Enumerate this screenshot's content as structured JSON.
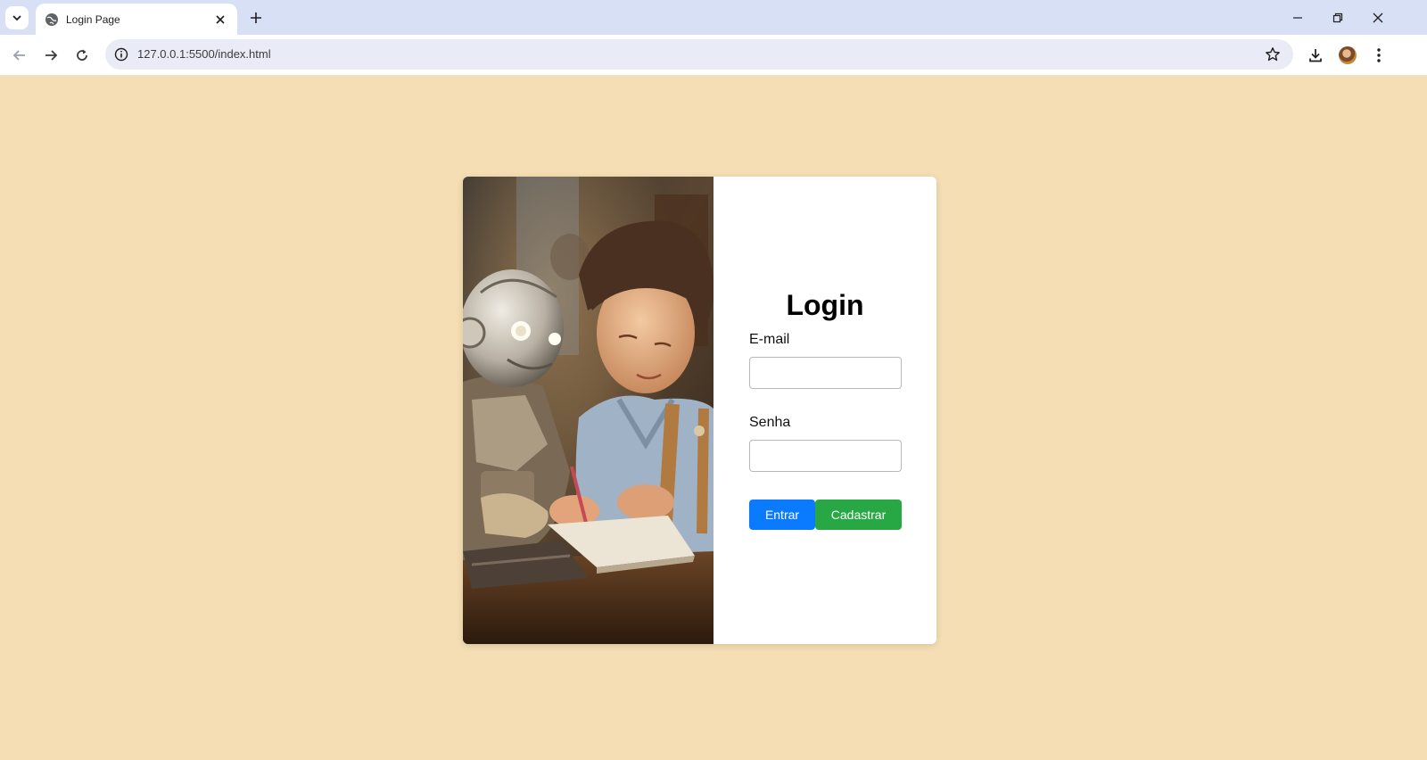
{
  "browser": {
    "tab_title": "Login Page",
    "url": "127.0.0.1:5500/index.html"
  },
  "login": {
    "title": "Login",
    "email_label": "E-mail",
    "email_value": "",
    "password_label": "Senha",
    "password_value": "",
    "submit_label": "Entrar",
    "register_label": "Cadastrar"
  },
  "colors": {
    "page_background": "#f5deb3",
    "submit_button": "#0a7bff",
    "register_button": "#28a745"
  }
}
